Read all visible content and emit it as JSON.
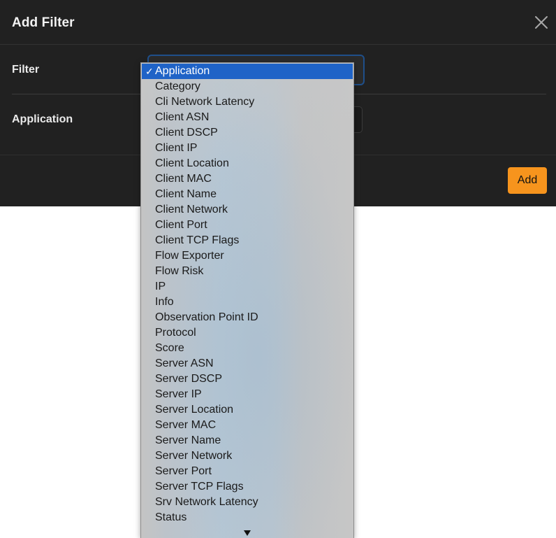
{
  "modal": {
    "title": "Add Filter",
    "filter_label": "Filter",
    "application_label": "Application",
    "add_label": "Add",
    "close_icon": "close-icon"
  },
  "dropdown": {
    "selected": "Application",
    "checkmark": "✓",
    "options": [
      "Application",
      "Category",
      "Cli Network Latency",
      "Client ASN",
      "Client DSCP",
      "Client IP",
      "Client Location",
      "Client MAC",
      "Client Name",
      "Client Network",
      "Client Port",
      "Client TCP Flags",
      "Flow Exporter",
      "Flow Risk",
      "IP",
      "Info",
      "Observation Point ID",
      "Protocol",
      "Score",
      "Server ASN",
      "Server DSCP",
      "Server IP",
      "Server Location",
      "Server MAC",
      "Server Name",
      "Server Network",
      "Server Port",
      "Server TCP Flags",
      "Srv Network Latency",
      "Status"
    ],
    "scroll_icon": "chevron-down-icon"
  },
  "colors": {
    "accent": "#f7941d",
    "modal_bg": "#212121",
    "selected_bg": "#1f63c7",
    "strip_chip_1": "#5b3b7a",
    "strip_chip_2": "#5b3b7a",
    "strip_chip_3": "#b8621c"
  }
}
